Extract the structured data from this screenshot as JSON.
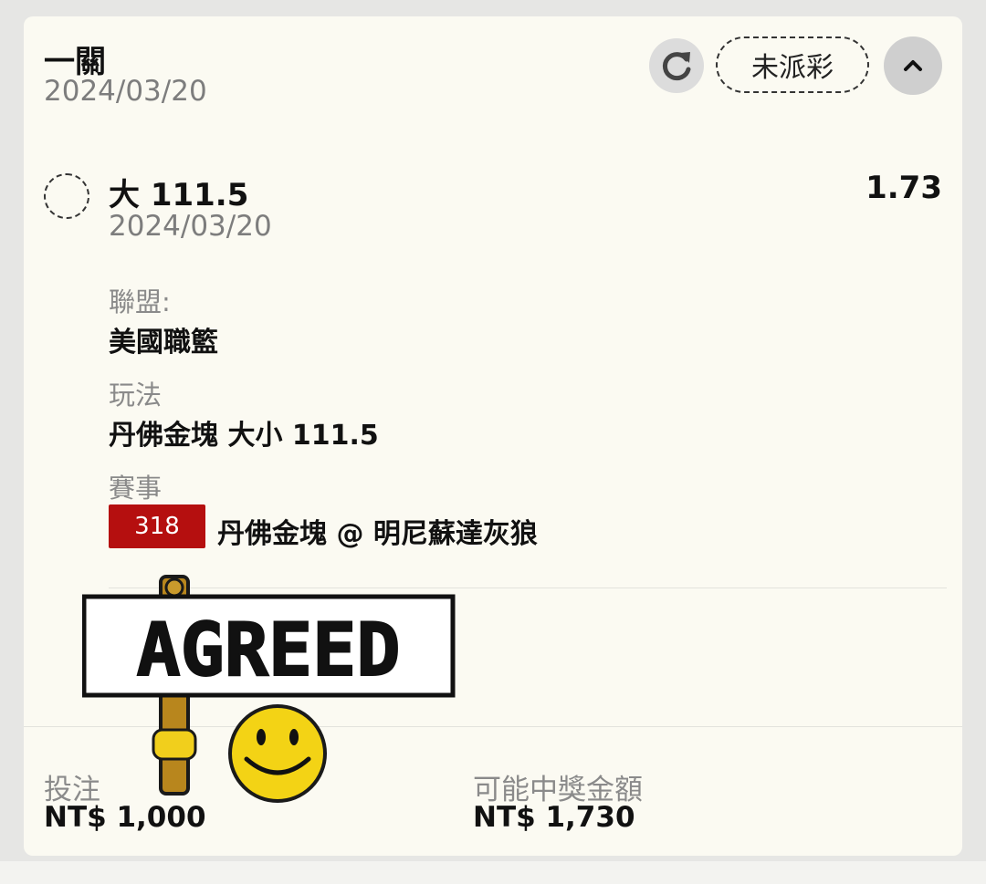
{
  "header": {
    "title": "一關",
    "date": "2024/03/20",
    "status_label": "未派彩"
  },
  "selection": {
    "name": "大 111.5",
    "date": "2024/03/20",
    "odds": "1.73"
  },
  "details": {
    "league_label": "聯盟:",
    "league_value": "美國職籃",
    "market_label": "玩法",
    "market_value": "丹佛金塊 大小 111.5",
    "event_label": "賽事",
    "event_id": "318",
    "event_name": "丹佛金塊 @ 明尼蘇達灰狼"
  },
  "sticker": {
    "text": "AGREED"
  },
  "footer": {
    "stake_label": "投注",
    "stake_value": "NT$ 1,000",
    "payout_label": "可能中獎金額",
    "payout_value": "NT$ 1,730"
  },
  "colors": {
    "event_badge": "#b50f0f",
    "card_bg": "#fbfaf2",
    "page_bg": "#e6e6e4"
  },
  "icons": {
    "refresh": "refresh-icon",
    "collapse": "chevron-up-icon"
  }
}
